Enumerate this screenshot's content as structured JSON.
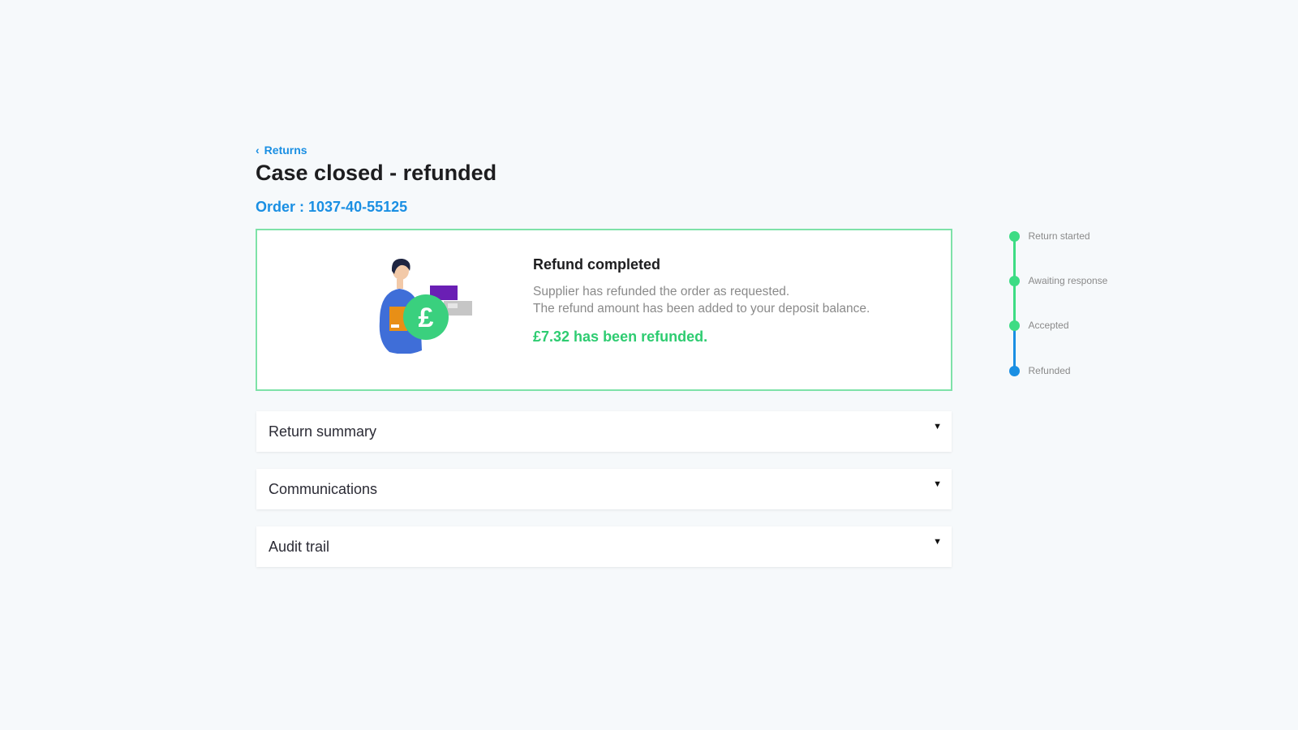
{
  "breadcrumb": {
    "back_label": "Returns"
  },
  "header": {
    "title": "Case closed - refunded",
    "order_prefix": "Order : ",
    "order_number": "1037-40-55125"
  },
  "refund_card": {
    "heading": "Refund completed",
    "description_line1": "Supplier has refunded the order as requested.",
    "description_line2": "The refund amount has been added to your deposit balance.",
    "amount_text": "£7.32 has been refunded.",
    "illustration_symbol": "£"
  },
  "sections": [
    {
      "label": "Return summary",
      "icon": "caret-down-icon"
    },
    {
      "label": "Communications",
      "icon": "caret-down-icon"
    },
    {
      "label": "Audit trail",
      "icon": "caret-down-icon"
    }
  ],
  "timeline": {
    "steps": [
      {
        "label": "Return started",
        "status": "complete"
      },
      {
        "label": "Awaiting response",
        "status": "complete"
      },
      {
        "label": "Accepted",
        "status": "complete"
      },
      {
        "label": "Refunded",
        "status": "current"
      }
    ]
  },
  "colors": {
    "accent_blue": "#1a8fe3",
    "success_green": "#2ecc71",
    "card_border": "#7ee2a8",
    "background": "#f6f9fb"
  }
}
